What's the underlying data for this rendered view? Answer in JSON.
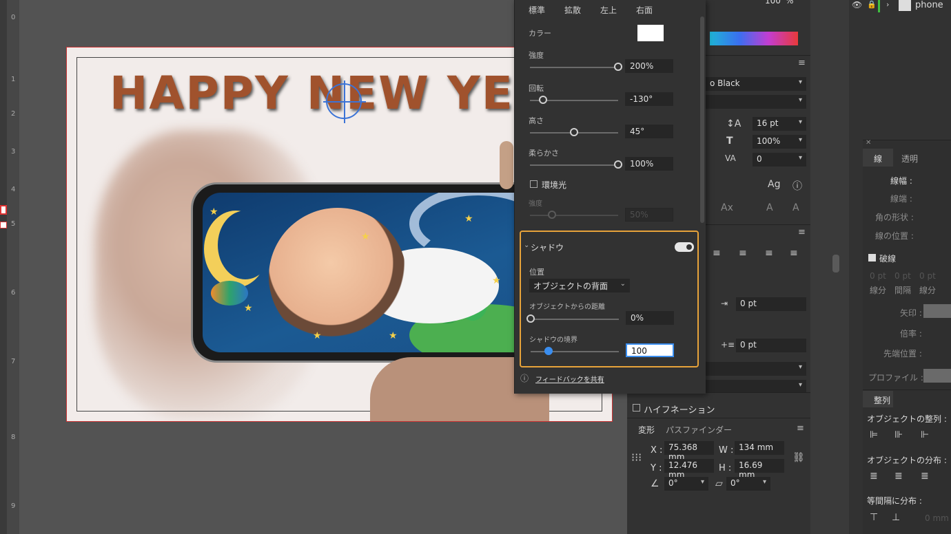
{
  "canvas": {
    "title_text": "HAPPY NEW YEA",
    "ruler_numbers": [
      "0",
      "1",
      "2",
      "3",
      "4",
      "5",
      "6",
      "7",
      "8",
      "9"
    ]
  },
  "effect_panel": {
    "tabs": [
      "標準",
      "拡散",
      "左上",
      "右面"
    ],
    "color_label": "カラー",
    "strength": {
      "label": "強度",
      "value": "200%",
      "level": 1.0
    },
    "rotation": {
      "label": "回転",
      "value": "-130°",
      "level": 0.15
    },
    "height": {
      "label": "高さ",
      "value": "45°",
      "level": 0.5
    },
    "softness": {
      "label": "柔らかさ",
      "value": "100%",
      "level": 1.0
    },
    "ambient": {
      "label": "環境光",
      "checked": false
    },
    "ambient_strength": {
      "label": "強度",
      "value": "50%",
      "level": 0.25
    },
    "shadow": {
      "title": "シャドウ",
      "enabled": true,
      "position_label": "位置",
      "position_value": "オブジェクトの背面",
      "distance": {
        "label": "オブジェクトからの距離",
        "value": "0%",
        "level": 0.0
      },
      "boundary": {
        "label": "シャドウの境界",
        "value": "100",
        "level": 0.2
      }
    },
    "feedback_link": "フィードバックを共有"
  },
  "char_panel": {
    "top_value": "100",
    "top_unit": "%",
    "font_style": "o Black",
    "leading": "16 pt",
    "scale": "100%",
    "tracking": "0",
    "indent": "0 pt",
    "space": "0 pt",
    "hyphenation": "ハイフネーション"
  },
  "transform_panel": {
    "tabs": [
      "変形",
      "パスファインダー"
    ],
    "x_label": "X :",
    "x_value": "75.368 mm",
    "w_label": "W :",
    "w_value": "134 mm",
    "y_label": "Y :",
    "y_value": "12.476 mm",
    "h_label": "H :",
    "h_value": "16.69 mm",
    "angle": "0°",
    "shear": "0°"
  },
  "layers_panel": {
    "layer_name": "phone"
  },
  "stroke_panel": {
    "tabs": [
      "線",
      "透明"
    ],
    "width_label": "線幅 :",
    "cap_label": "線端 :",
    "corner_label": "角の形状 :",
    "align_label": "線の位置 :",
    "dashed_label": "破線",
    "dash_fields": [
      "0 pt",
      "0 pt",
      "0 pt"
    ],
    "dash_sub": [
      "線分",
      "間隔",
      "線分"
    ],
    "arrow_label": "矢印 :",
    "scale_label": "倍率 :",
    "align_arrow_label": "先端位置 :",
    "profile_label": "プロファイル :",
    "align_tab": "整列",
    "obj_align_label": "オブジェクトの整列 :",
    "obj_distribute_label": "オブジェクトの分布 :",
    "equal_distribute_label": "等間隔に分布 :",
    "spacing_value": "0 mm"
  },
  "colors": {
    "accent_orange": "#e8a33a",
    "accent_blue": "#3a8ef0",
    "artboard_border": "#cc3333"
  }
}
